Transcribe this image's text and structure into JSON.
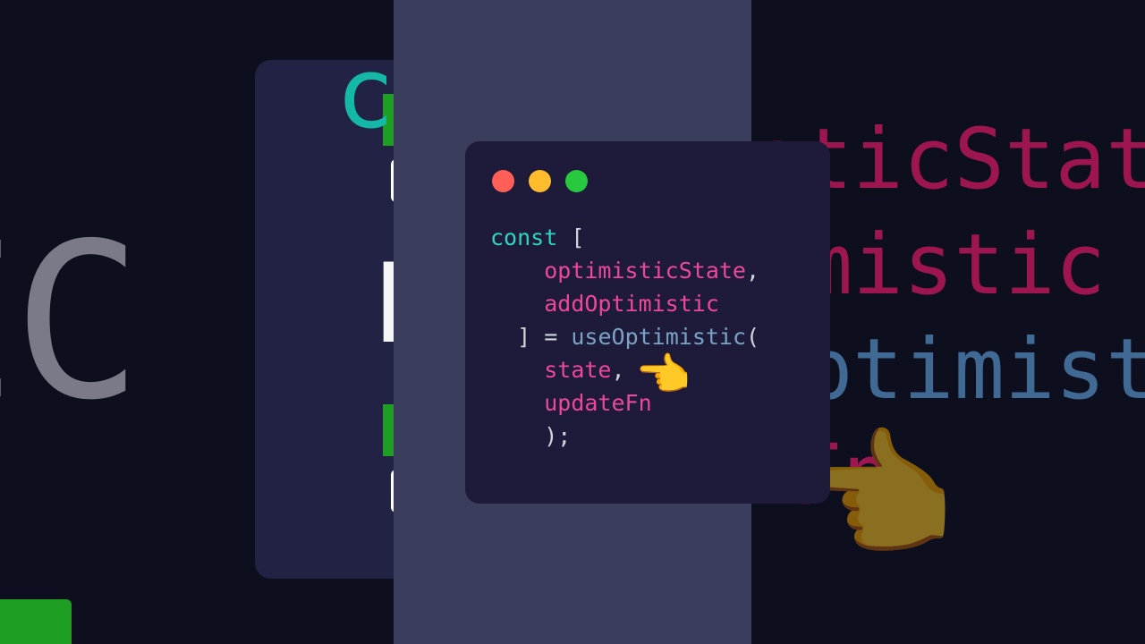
{
  "background": {
    "left_blur_text_1": "IC",
    "left_blur_text_2": "co",
    "left_blur_text_3": "IC",
    "right_blur_line1": "sticState",
    "right_blur_line2": "imistic",
    "right_blur_line3": "optimistic",
    "right_blur_line4": "Fn"
  },
  "code": {
    "keyword": "const",
    "bracket_open": "[",
    "var1": "optimisticState",
    "comma1": ",",
    "var2": "addOptimistic",
    "bracket_close": "]",
    "equals": "=",
    "fn": "useOptimistic",
    "paren_open": "(",
    "arg1": "state",
    "comma2": ",",
    "arg2": "updateFn",
    "closing": ");"
  },
  "colors": {
    "bg_dark": "#0d0f1f",
    "center_col": "#3a3e5c",
    "window_bg": "#1e1b3a",
    "keyword": "#2dd4bf",
    "variable": "#ec4899",
    "function": "#7aa2c4",
    "punct": "#d1d5db",
    "traffic_red": "#ff5f56",
    "traffic_yellow": "#ffbd2e",
    "traffic_green": "#27c93f"
  },
  "emoji": {
    "pointer": "👈"
  }
}
